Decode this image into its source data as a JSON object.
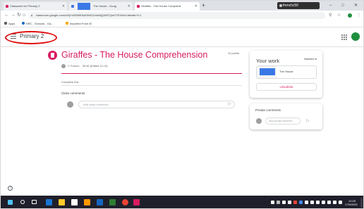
{
  "browser": {
    "tabs": [
      {
        "label": "Classwork for Primary 2",
        "active": false,
        "favicon_color": "#d81b60"
      },
      {
        "label": "The House - Goog",
        "active": false,
        "favicon_color": "#3b78e7"
      },
      {
        "label": "Giraffes - The House Comprehe",
        "active": true,
        "favicon_color": "#d81b60"
      }
    ],
    "new_tab_symbol": "+",
    "profile_name": "frenchc50",
    "window_controls": {
      "minimize": "–",
      "maximize": "□",
      "close": "✕"
    },
    "url": "classroom.google.com/c/NjYxNDMKNzE0NGZx/a/NjQ4MTQwOTE1NzI1/details?t=1",
    "bookmarks": [
      {
        "label": "Apps",
        "icon_color": "#5f6368"
      },
      {
        "label": "SRC - Schools - Ga...",
        "icon_color": "#1565c0"
      },
      {
        "label": "Imported From IE",
        "icon_color": "#f9ab00"
      }
    ]
  },
  "classroom": {
    "class_name": "Primary 2",
    "annotation_color": "#e01010"
  },
  "assignment": {
    "title": "Giraffes - The House Comprehension",
    "points": "10 points",
    "author": "C French",
    "date": "05:46 (Edited 11:13)",
    "due": "Complete this",
    "class_comments_label": "Class comments",
    "comment_placeholder": "Add class comment...",
    "accent_color": "#d81b60"
  },
  "your_work": {
    "title": "Your work",
    "status": "Handed in",
    "attachment_name": "The House",
    "unsubmit_label": "Unsubmit"
  },
  "private_comments": {
    "title": "Private comments",
    "placeholder": "Add private comment..."
  },
  "help_icon": "?",
  "taskbar": {
    "time": "12:29",
    "date": "17/04/2020",
    "icon_colors": [
      "#1976d2",
      "#ffca28",
      "#ffffff",
      "#ff9800",
      "#1565c0",
      "#2e7d32",
      "#ea4335",
      "#d81b60"
    ],
    "tray_colors": [
      "#ffffff",
      "#bdbdbd",
      "#ffffff",
      "#ffffff",
      "#ea4335",
      "#4285f4",
      "#ffffff",
      "#ffffff",
      "#ffffff",
      "#ffffff",
      "#ffffff",
      "#ffffff",
      "#ffffff"
    ]
  }
}
